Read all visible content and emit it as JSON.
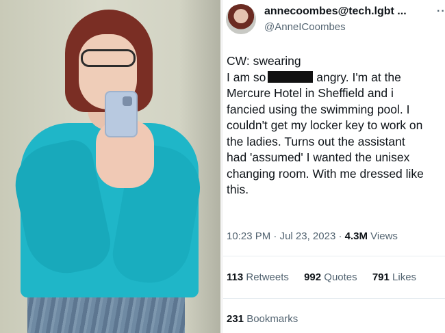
{
  "tweet": {
    "display_name": "annecoombes@tech.lgbt ...",
    "handle": "@AnneIСoombes",
    "more": "··",
    "lines": [
      "CW: swearing",
      "I am so",
      "angry. I'm at the",
      "Mercure Hotel in Sheffield and i",
      "fancied using the swimming pool. I",
      "couldn't get my locker key to work on",
      "the ladies. Turns out the assistant",
      "had 'assumed' I wanted the unisex",
      "changing room. With me dressed like",
      "this."
    ],
    "time": "10:23 PM",
    "date": "Jul 23, 2023",
    "views_count": "4.3M",
    "views_label": "Views",
    "retweets_count": "113",
    "retweets_label": "Retweets",
    "quotes_count": "992",
    "quotes_label": "Quotes",
    "likes_count": "791",
    "likes_label": "Likes",
    "bookmarks_count": "231",
    "bookmarks_label": "Bookmarks",
    "separator": "·"
  },
  "icons": {
    "more": "more-options-icon"
  }
}
